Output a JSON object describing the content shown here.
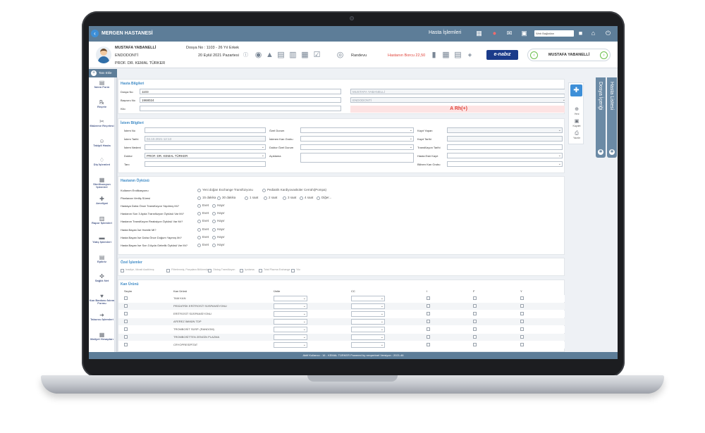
{
  "topbar": {
    "hospital": "MERGEN HASTANESİ",
    "menu_label": "Hasta İşlemleri",
    "search_select": "Web Bağlatları"
  },
  "patient": {
    "name": "MUSTAFA YABANELLİ",
    "department": "ENDODONTİ",
    "doctor": "PROF. DR. KEMAL TÜRKER",
    "file_info": "Dosya No : 1103 - 26 Yıl Erkek",
    "date": "20 Eylül 2021 Pazartesi",
    "appointment": "Randevu",
    "debt": "Hastanın Borcu 22,50",
    "nabiz": "e-nabız",
    "nav_name": "MUSTAFA YABANELLİ"
  },
  "tani_button": "Tanı Ekle",
  "sidebar": [
    {
      "label": "İstem Form",
      "icon": "form-icon"
    },
    {
      "label": "Reçete",
      "icon": "prescription-icon"
    },
    {
      "label": "Malzeme Reçetesi",
      "icon": "material-icon"
    },
    {
      "label": "Takipli Hasta",
      "icon": "follow-icon"
    },
    {
      "label": "Diş İşlemleri",
      "icon": "tooth-icon"
    },
    {
      "label": "Sterilizasyon İşlemleri",
      "icon": "sterilization-icon"
    },
    {
      "label": "Ameliyat",
      "icon": "surgery-icon"
    },
    {
      "label": "Rapor İşlemleri",
      "icon": "report-icon"
    },
    {
      "label": "Yatış İşlemleri",
      "icon": "bed-icon"
    },
    {
      "label": "Epikriz",
      "icon": "epicrisis-icon"
    },
    {
      "label": "Sağlık Net",
      "icon": "health-icon"
    },
    {
      "label": "Kan Bankası İstem Formu",
      "icon": "blood-bank-icon"
    },
    {
      "label": "Taburcu İşlemleri",
      "icon": "discharge-icon"
    },
    {
      "label": "Maliyet Hesapları",
      "icon": "cost-icon"
    }
  ],
  "hasta_bilgileri": {
    "title": "Hasta Bilgileri",
    "dosya_no_label": "Dosya No",
    "dosya_no": "1103",
    "basvuru_label": "Başvuru No",
    "basvuru": "1968024",
    "kilo_label": "Kilo",
    "name_ro": "MUSTAFA YABANELLİ",
    "dept_ro": "ENDODONTİ",
    "blood_group": "A Rh(+)"
  },
  "istem": {
    "title": "İstem Bilgileri",
    "istem_no": "İstem No",
    "istem_tarihi": "İstem Tarihi",
    "istem_tarihi_val": "04.10.2021 12:13",
    "istem_nedeni": "İstem Nedeni",
    "doktor": "Doktor",
    "doktor_val": "PROF. DR.   KEMAL TÜRKER",
    "tani": "Tanı",
    "ozel_durum": "Özel Durum",
    "istenen_kan": "İstenen Kan Grubu",
    "doktor_ozel": "Doktor Özel Durum",
    "aciklama": "Açıklama",
    "kayit_yapan": "Kayıt Yapan",
    "kayit_tarihi": "Kayıt Tarihi",
    "transfuzyon_tarihi": "Transfüzyon Tarihi",
    "hasta_eski_kayit": "Hasta Eski Kayıt",
    "bilinen_kan": "Bilinen Kan Grubu"
  },
  "hastanin_oykusu": {
    "title": "Hastanın Öyküsü",
    "q1": "Kullanım Endikasyonu",
    "q1_opts": [
      "Yeni doğan Exchange Transfüzyonu",
      "Pediatrik Kardiyovasküler Cerrahi(Pompa)"
    ],
    "q2": "Planlanan Veriliş Süresi",
    "q2_opts": [
      "15 dakika",
      "30 dakika",
      "1 saat",
      "2 saat",
      "3 saat",
      "4 saat",
      "Diğer..."
    ],
    "questions": [
      "Hastaya Daha Önce Transfüzyon Yapılmış Mı?",
      "Hastanın Son 3 Ayda Transfüzyon Öyküsü Var Mı?",
      "Hastanın Transfüzyon Reaksiyon Öyküsü Var Mı?",
      "Hasta Bayan İse Hamile Mi?",
      "Hasta Bayan İse Daha Önce Doğum Yapmış Mı?",
      "Hasta Bayan İse Son 3 Ayda Gebelik Öyküsü Var Mı?"
    ],
    "evet": "Evet",
    "hayir": "Hayır"
  },
  "ozel_islemler": {
    "title": "Özel İşlemler",
    "items": [
      "Irradiye, lökosit Azaltılmış",
      "Filtrelenmiş, Parçalara Bölünmüş",
      "Ototog Transfüzyon",
      "Işınlama",
      "Total Plazma Exchange",
      "Yıkı"
    ]
  },
  "kan_urunu": {
    "title": "Kan Ürünü",
    "headers": [
      "Seçim",
      "Kan Ürünü",
      "Ünite",
      "CC",
      "I",
      "F",
      "Y"
    ],
    "rows": [
      "TAM KAN",
      "PEDİATRİK ERİTROSİT SÜSPANSİYONU",
      "ERİTROSİT SÜSPANSİYONU",
      "AFEREZ İMMÜN TDP",
      "TROMBOSİT SÜSP. (RANDOM)",
      "TROMBOSİTTEN ZENGİN PLAZMA",
      "CRYOPRESİPİTAT"
    ]
  },
  "right_tools": [
    "Yeni",
    "Kaydet",
    "Yazdır"
  ],
  "right_tabs": [
    "Dosya İçeriği",
    "Hasta Listesi"
  ],
  "status_bar": "Aktif Kullanıcı : 16 - KEMAL TÜRKER    Powered by nexpertnet    Versiyon : 2021.46"
}
